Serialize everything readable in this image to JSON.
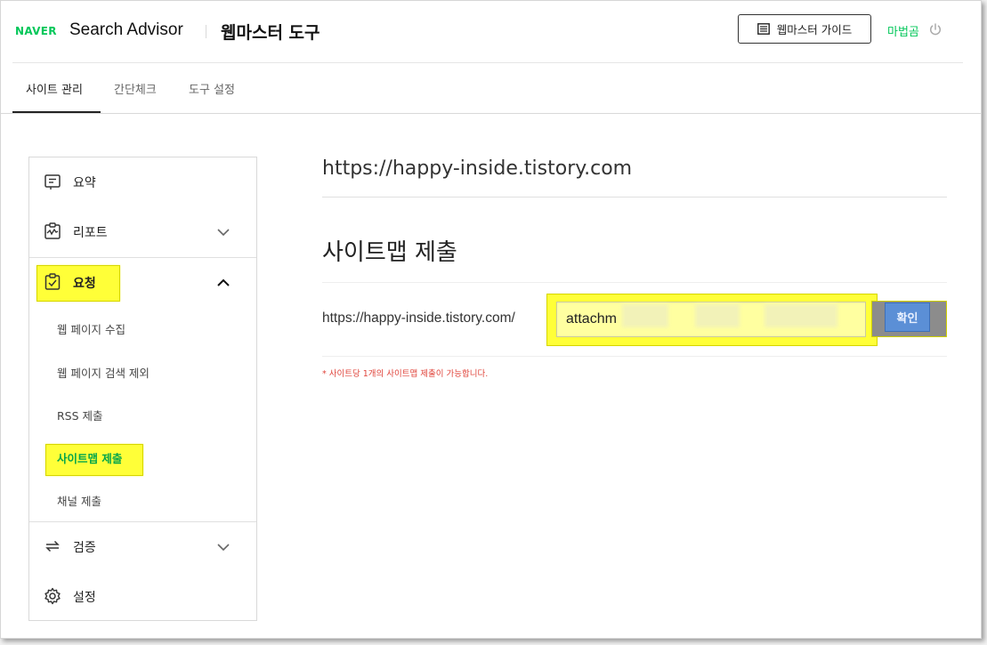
{
  "header": {
    "brand": "NAVER",
    "product": "Search Advisor",
    "tool_title": "웹마스터 도구",
    "guide_button": "웹마스터 가이드",
    "user_name": "마법곰",
    "icons": [
      "guide-icon",
      "power-icon"
    ]
  },
  "tabs": [
    {
      "label": "사이트 관리",
      "active": true
    },
    {
      "label": "간단체크",
      "active": false
    },
    {
      "label": "도구 설정",
      "active": false
    }
  ],
  "sidebar": {
    "items": [
      {
        "label": "요약",
        "icon": "summary-icon"
      },
      {
        "label": "리포트",
        "icon": "report-icon",
        "expanded": false
      },
      {
        "label": "요청",
        "icon": "request-icon",
        "expanded": true
      },
      {
        "label": "검증",
        "icon": "verify-icon",
        "expanded": false
      },
      {
        "label": "설정",
        "icon": "settings-icon"
      }
    ],
    "request_sub": [
      {
        "label": "웹 페이지 수집"
      },
      {
        "label": "웹 페이지 검색 제외"
      },
      {
        "label": "RSS 제출"
      },
      {
        "label": "사이트맵 제출",
        "active": true
      },
      {
        "label": "채널 제출"
      }
    ]
  },
  "main": {
    "site_url": "https://happy-inside.tistory.com",
    "section_title": "사이트맵 제출",
    "url_prefix": "https://happy-inside.tistory.com/",
    "input_value": "attachm",
    "confirm_button": "확인",
    "notice": "* 사이트당 1개의 사이트맵 제출이 가능합니다."
  },
  "colors": {
    "brand_green": "#03c75a",
    "highlight": "#ffff38",
    "notice_red": "#e0443b",
    "button_blue": "#5b8fd6"
  }
}
